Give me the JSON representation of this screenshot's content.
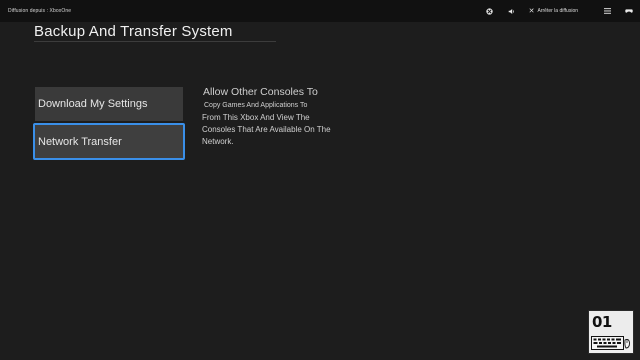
{
  "titlebar": {
    "title": "Diffusion depuis : XboxOne",
    "icons": [
      "xbox-icon",
      "volume-icon",
      "close-icon",
      "menu-icon",
      "controller-icon"
    ],
    "stop_label": "Arrêter la diffusion"
  },
  "page": {
    "title": "Backup And Transfer System"
  },
  "menu": {
    "items": [
      {
        "label": "Download My Settings",
        "selected": false
      },
      {
        "label": "Network Transfer",
        "selected": true
      }
    ]
  },
  "description": {
    "heading": "Allow Other Consoles To",
    "lines": [
      "Copy Games And Applications To",
      "From This Xbox And View The",
      "Consoles That Are Available On The",
      "Network."
    ]
  },
  "watermark": {
    "text": "01",
    "name": "01net-logo"
  },
  "colors": {
    "background": "#1d1d1d",
    "titlebar": "#111111",
    "menu_item": "#3a3a3a",
    "focus_border": "#3a8fe8"
  }
}
